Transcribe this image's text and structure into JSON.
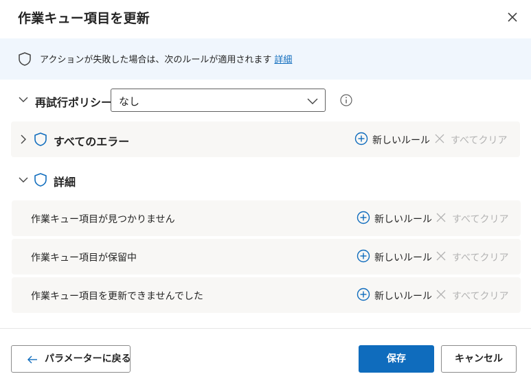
{
  "dialog": {
    "title": "作業キュー項目を更新"
  },
  "banner": {
    "text": "アクションが失敗した場合は、次のルールが適用されます",
    "link": "詳細"
  },
  "retry_policy": {
    "label": "再試行ポリシー",
    "selected": "なし"
  },
  "sections": {
    "all_errors": {
      "title": "すべてのエラー",
      "new_rule": "新しいルール",
      "clear_all": "すべてクリア"
    },
    "details": {
      "title": "詳細",
      "rows": [
        {
          "label": "作業キュー項目が見つかりません",
          "new_rule": "新しいルール",
          "clear_all": "すべてクリア"
        },
        {
          "label": "作業キュー項目が保留中",
          "new_rule": "新しいルール",
          "clear_all": "すべてクリア"
        },
        {
          "label": "作業キュー項目を更新できませんでした",
          "new_rule": "新しいルール",
          "clear_all": "すべてクリア"
        }
      ]
    }
  },
  "footer": {
    "back_label": "パラメーターに戻る",
    "save_label": "保存",
    "cancel_label": "キャンセル"
  },
  "colors": {
    "accent": "#0f6cbd",
    "banner_bg": "#f0f6fd",
    "panel_bg": "#f8f7f5",
    "disabled_text": "#b3b3b3"
  },
  "icons": {
    "close": "close-icon",
    "banner": "shield-icon",
    "info": "info-icon",
    "add": "add-circle-icon",
    "clear": "dismiss-icon",
    "back": "arrow-left-icon"
  }
}
